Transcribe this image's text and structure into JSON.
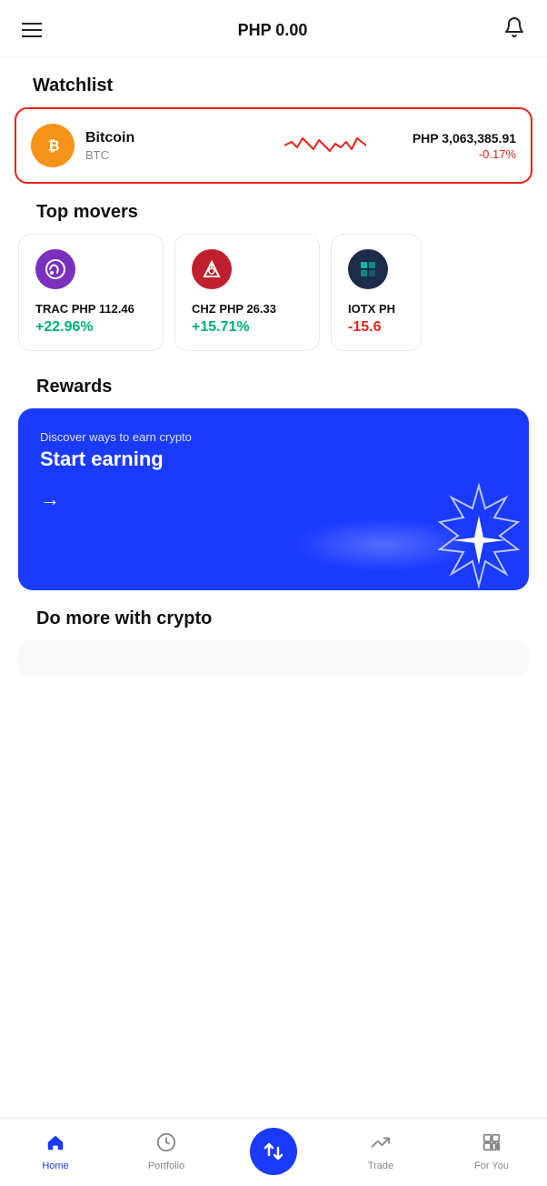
{
  "header": {
    "balance": "PHP 0.00",
    "hamburger_label": "menu",
    "bell_label": "notifications"
  },
  "watchlist": {
    "title": "Watchlist",
    "bitcoin": {
      "name": "Bitcoin",
      "ticker": "BTC",
      "price": "PHP 3,063,385.91",
      "change": "-0.17%"
    }
  },
  "top_movers": {
    "title": "Top movers",
    "items": [
      {
        "ticker": "TRAC",
        "price": "PHP 112.46",
        "change": "+22.96%",
        "positive": true
      },
      {
        "ticker": "CHZ",
        "price": "PHP 26.33",
        "change": "+15.71%",
        "positive": true
      },
      {
        "ticker": "IOTX",
        "price": "PH...",
        "change": "-15.6",
        "positive": false
      }
    ]
  },
  "rewards": {
    "title": "Rewards",
    "subtitle": "Discover ways to earn crypto",
    "cta": "Start earning"
  },
  "do_more": {
    "title": "Do more with crypto"
  },
  "bottom_nav": {
    "home": "Home",
    "portfolio": "Portfolio",
    "trade_icon": "swap",
    "trade": "Trade",
    "for_you": "For You"
  }
}
